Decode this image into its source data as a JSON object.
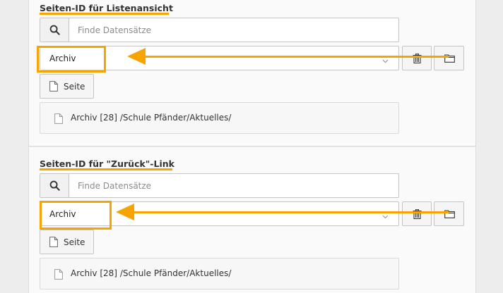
{
  "sections": [
    {
      "label": "Seiten-ID für Listenansicht",
      "search_placeholder": "Finde Datensätze",
      "selected_value": "Archiv",
      "page_button_label": "Seite",
      "record_title": "Archiv",
      "record_id": "[28]",
      "record_path": "/Schule Pfänder/Aktuelles/"
    },
    {
      "label": "Seiten-ID für \"Zurück\"-Link",
      "search_placeholder": "Finde Datensätze",
      "selected_value": "Archiv",
      "page_button_label": "Seite",
      "record_title": "Archiv",
      "record_id": "[28]",
      "record_path": "/Schule Pfänder/Aktuelles/"
    }
  ],
  "icons": {
    "search": "search-icon",
    "delete": "trash-icon",
    "browse": "folder-icon",
    "page": "page-icon",
    "chevron": "chevron-down-icon"
  },
  "colors": {
    "annotation": "#f7a400",
    "panel_bg": "#fafafa",
    "page_bg": "#ededed"
  }
}
